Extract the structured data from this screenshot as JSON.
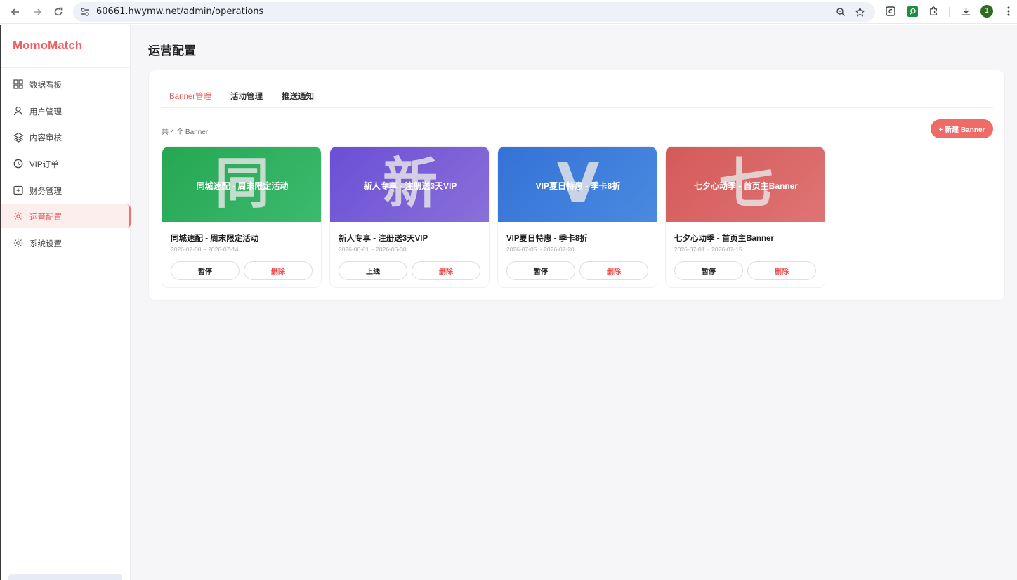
{
  "browser": {
    "url": "60661.hwymw.net/admin/operations",
    "profile_initial": "1"
  },
  "sidebar": {
    "brand": "MomoMatch",
    "items": [
      {
        "label": "数据看板",
        "icon": "grid-icon"
      },
      {
        "label": "用户管理",
        "icon": "user-icon"
      },
      {
        "label": "内容审核",
        "icon": "layers-icon"
      },
      {
        "label": "VIP订单",
        "icon": "clock-icon"
      },
      {
        "label": "财务管理",
        "icon": "plus-box-icon"
      },
      {
        "label": "运营配置",
        "icon": "sun-icon",
        "active": true
      },
      {
        "label": "系统设置",
        "icon": "settings-icon"
      }
    ]
  },
  "main": {
    "page_title": "运营配置",
    "tabs": [
      {
        "label": "Banner管理",
        "active": true
      },
      {
        "label": "活动管理"
      },
      {
        "label": "推送通知"
      }
    ],
    "count_text": "共 4 个 Banner",
    "new_button": "+ 新建 Banner",
    "banners": [
      {
        "glyph": "同",
        "caption": "同城速配 - 周末限定活动",
        "title": "同城速配 - 周末限定活动",
        "dates": "2026-07-08 ~ 2026-07-14",
        "toggle_label": "暂停",
        "delete_label": "删除",
        "color": "#25a752"
      },
      {
        "glyph": "新",
        "caption": "新人专享 - 注册送3天VIP",
        "title": "新人专享 - 注册送3天VIP",
        "dates": "2026-06-01 ~ 2026-06-30",
        "toggle_label": "上线",
        "delete_label": "删除",
        "color": "#6a4fd6"
      },
      {
        "glyph": "V",
        "caption": "VIP夏日特惠 - 季卡8折",
        "title": "VIP夏日特惠 - 季卡8折",
        "dates": "2026-07-05 ~ 2026-07-20",
        "toggle_label": "暂停",
        "delete_label": "删除",
        "color": "#3472d6"
      },
      {
        "glyph": "七",
        "caption": "七夕心动季 - 首页主Banner",
        "title": "七夕心动季 - 首页主Banner",
        "dates": "2026-07-01 ~ 2026-07-15",
        "toggle_label": "暂停",
        "delete_label": "删除",
        "color": "#d45a5a"
      }
    ]
  },
  "colors": {
    "accent": "#f06a68",
    "active_bg": "#fdeeee",
    "page_bg": "#f6f6f8"
  }
}
